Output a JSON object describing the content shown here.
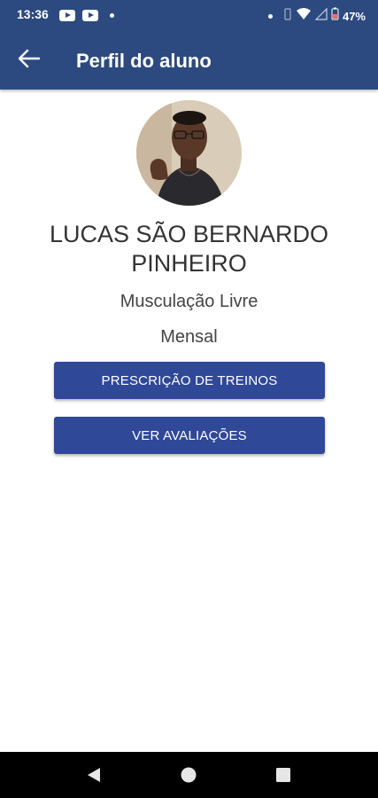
{
  "status_bar": {
    "time": "13:36",
    "battery": "47%",
    "icons": [
      "youtube-icon",
      "youtube-icon",
      "notification-dot-icon",
      "wifi-icon",
      "signal-icon",
      "battery-icon"
    ]
  },
  "app_bar": {
    "title": "Perfil do aluno",
    "back_icon": "arrow-left-icon"
  },
  "profile": {
    "name": "LUCAS SÃO BERNARDO PINHEIRO",
    "modality": "Musculação Livre",
    "plan": "Mensal"
  },
  "actions": {
    "prescription_label": "PRESCRIÇÃO DE TREINOS",
    "evaluations_label": "VER AVALIAÇÕES"
  },
  "colors": {
    "app_bar": "#2c4a7f",
    "button": "#2f4898",
    "nav_bar": "#000000"
  },
  "nav_bar": {
    "icons": [
      "back-triangle-icon",
      "home-circle-icon",
      "recents-square-icon"
    ]
  }
}
